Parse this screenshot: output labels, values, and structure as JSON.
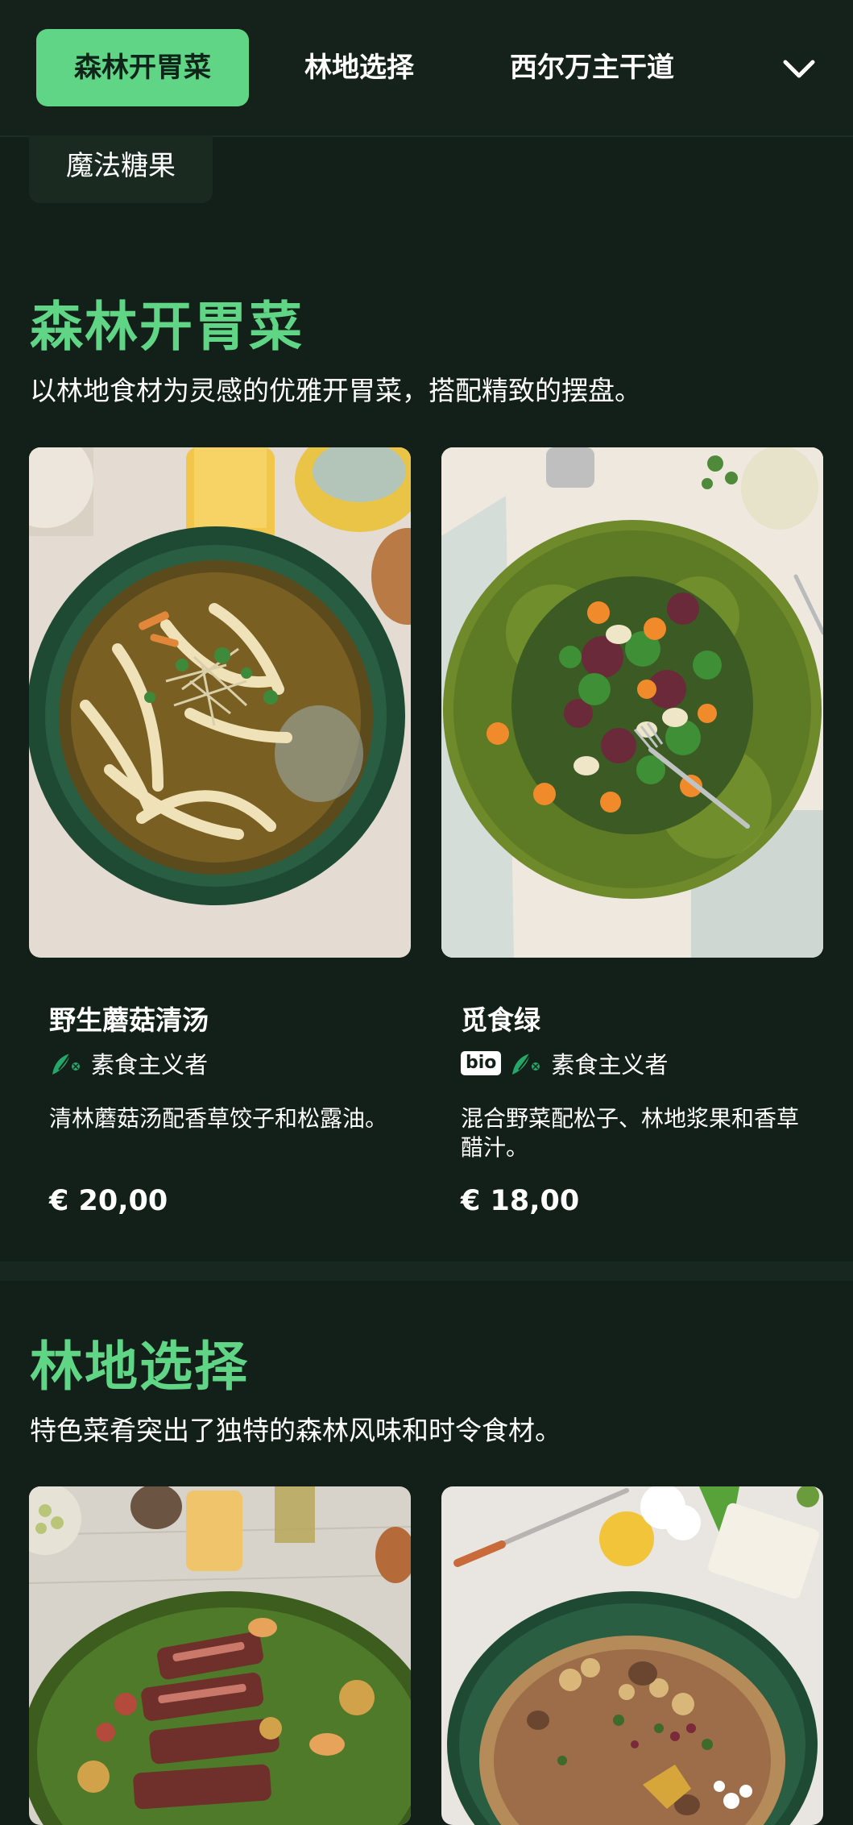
{
  "nav": {
    "tabs": [
      {
        "label": "森林开胃菜",
        "active": true
      },
      {
        "label": "林地选择",
        "active": false
      },
      {
        "label": "西尔万主干道",
        "active": false
      }
    ],
    "more_icon": "chevron-down-icon",
    "overflow_chip": "魔法糖果"
  },
  "sections": [
    {
      "title": "森林开胃菜",
      "description": "以林地食材为灵感的优雅开胃菜，搭配精致的摆盘。",
      "items": [
        {
          "name": "野生蘑菇清汤",
          "bio": false,
          "diet": "素食主义者",
          "description": "清林蘑菇汤配香草饺子和松露油。",
          "price": "€ 20,00"
        },
        {
          "name": "觅食绿",
          "bio": true,
          "bio_label": "bio",
          "diet": "素食主义者",
          "description": "混合野菜配松子、林地浆果和香草醋汁。",
          "price": "€ 18,00"
        }
      ]
    },
    {
      "title": "林地选择",
      "description": "特色菜肴突出了独特的森林风味和时令食材。"
    }
  ],
  "colors": {
    "background": "#13201a",
    "accent": "#5fd585",
    "tab_active_text": "#10251a"
  }
}
